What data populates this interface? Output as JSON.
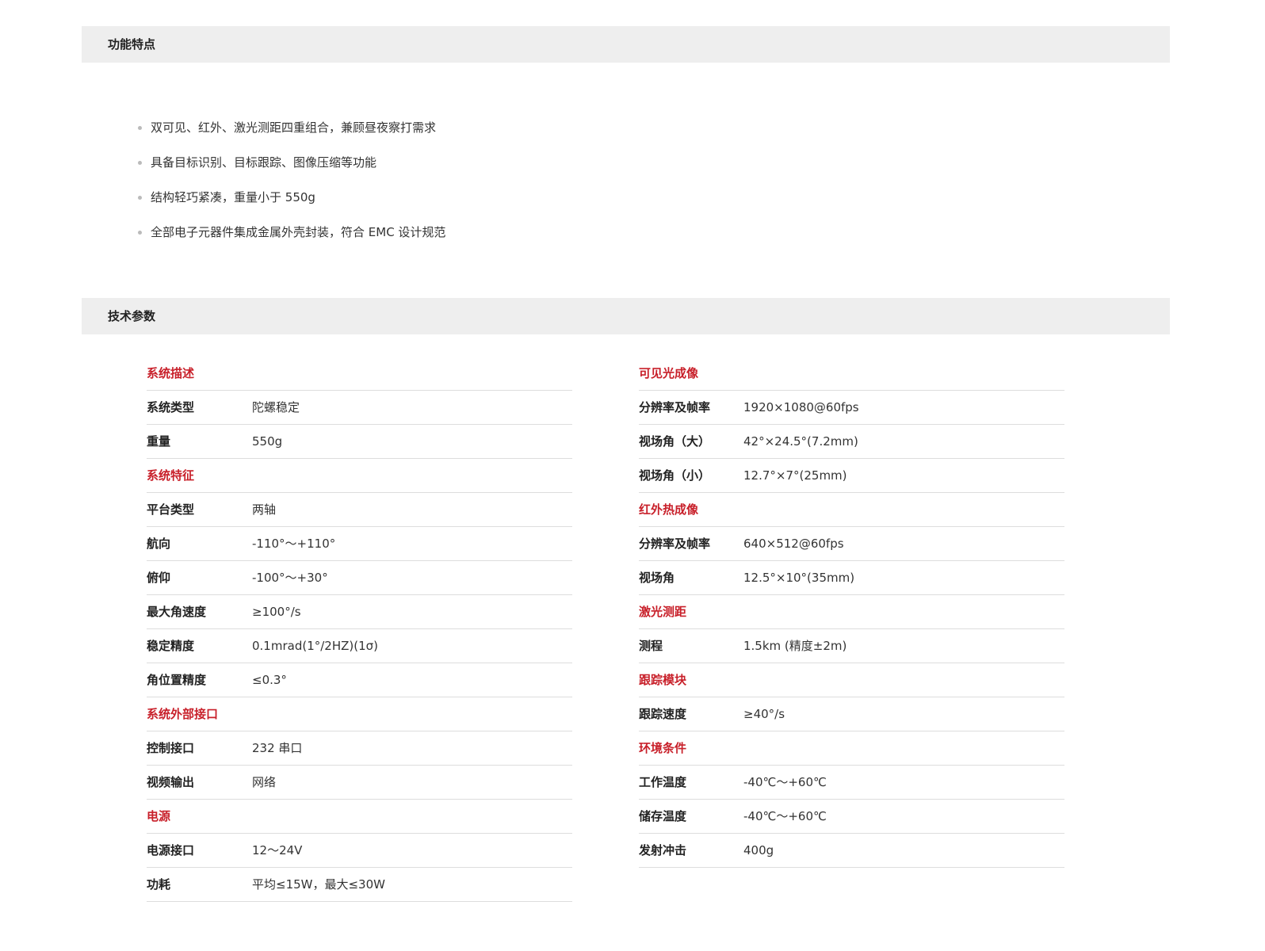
{
  "features_section": {
    "title": "功能特点",
    "items": [
      "双可见、红外、激光测距四重组合，兼顾昼夜察打需求",
      "具备目标识别、目标跟踪、图像压缩等功能",
      "结构轻巧紧凑，重量小于 550g",
      "全部电子元器件集成金属外壳封装，符合 EMC 设计规范"
    ]
  },
  "specs_section": {
    "title": "技术参数",
    "left_column": [
      {
        "type": "heading",
        "label": "系统描述"
      },
      {
        "type": "row",
        "key": "系统类型",
        "value": "陀螺稳定"
      },
      {
        "type": "row",
        "key": "重量",
        "value": "550g"
      },
      {
        "type": "heading",
        "label": "系统特征"
      },
      {
        "type": "row",
        "key": "平台类型",
        "value": "两轴"
      },
      {
        "type": "row",
        "key": "航向",
        "value": "-110°～+110°"
      },
      {
        "type": "row",
        "key": "俯仰",
        "value": "-100°～+30°"
      },
      {
        "type": "row",
        "key": "最大角速度",
        "value": "≥100°/s"
      },
      {
        "type": "row",
        "key": "稳定精度",
        "value": "0.1mrad(1°/2HZ)(1σ)"
      },
      {
        "type": "row",
        "key": "角位置精度",
        "value": "≤0.3°"
      },
      {
        "type": "heading",
        "label": "系统外部接口"
      },
      {
        "type": "row",
        "key": "控制接口",
        "value": "232 串口"
      },
      {
        "type": "row",
        "key": "视频输出",
        "value": "网络"
      },
      {
        "type": "heading",
        "label": "电源"
      },
      {
        "type": "row",
        "key": "电源接口",
        "value": "12～24V"
      },
      {
        "type": "row",
        "key": "功耗",
        "value": "平均≤15W，最大≤30W"
      }
    ],
    "right_column": [
      {
        "type": "heading",
        "label": "可见光成像"
      },
      {
        "type": "row",
        "key": "分辨率及帧率",
        "value": "1920×1080@60fps"
      },
      {
        "type": "row",
        "key": "视场角（大）",
        "value": "42°×24.5°(7.2mm)"
      },
      {
        "type": "row",
        "key": "视场角（小）",
        "value": "12.7°×7°(25mm)"
      },
      {
        "type": "heading",
        "label": "红外热成像"
      },
      {
        "type": "row",
        "key": "分辨率及帧率",
        "value": "640×512@60fps"
      },
      {
        "type": "row",
        "key": "视场角",
        "value": "12.5°×10°(35mm)"
      },
      {
        "type": "heading",
        "label": "激光测距"
      },
      {
        "type": "row",
        "key": "测程",
        "value": "1.5km (精度±2m)"
      },
      {
        "type": "heading",
        "label": "跟踪模块"
      },
      {
        "type": "row",
        "key": "跟踪速度",
        "value": "≥40°/s"
      },
      {
        "type": "heading",
        "label": "环境条件"
      },
      {
        "type": "row",
        "key": "工作温度",
        "value": "-40℃～+60℃"
      },
      {
        "type": "row",
        "key": "储存温度",
        "value": "-40℃～+60℃"
      },
      {
        "type": "row",
        "key": "发射冲击",
        "value": "400g"
      }
    ]
  },
  "colors": {
    "accent_heading": "#c8202a",
    "bar_background": "#eeeeee",
    "divider": "#dddddd",
    "bullet": "#bbbbbb"
  }
}
